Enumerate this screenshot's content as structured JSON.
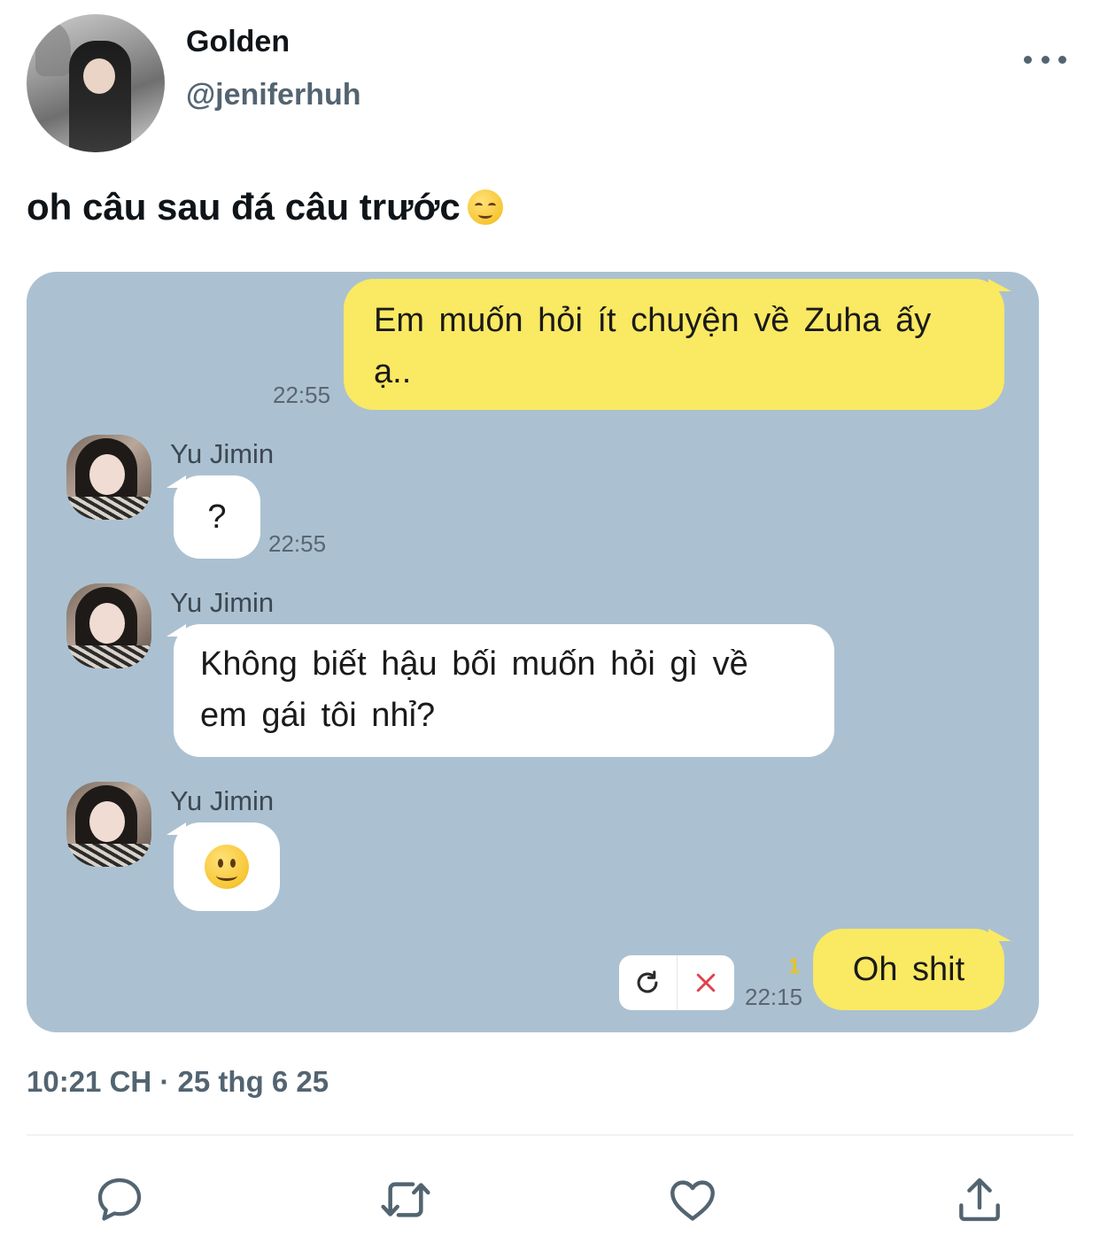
{
  "author": {
    "display_name": "Golden",
    "handle": "@jeniferhuh"
  },
  "tweet": {
    "text": "oh câu sau đá câu trước",
    "emoji": "smiling-face-icon"
  },
  "chat": {
    "messages": [
      {
        "side": "right",
        "text_line1": "Em muốn hỏi ít chuyện về Zuha ấy",
        "text_line2": "ạ..",
        "time": "22:55"
      },
      {
        "side": "left",
        "sender": "Yu Jimin",
        "text": "?",
        "time": "22:55"
      },
      {
        "side": "left",
        "sender": "Yu Jimin",
        "text_line1": "Không biết hậu bối muốn hỏi gì về",
        "text_line2": "em gái tôi nhỉ?"
      },
      {
        "side": "left",
        "sender": "Yu Jimin",
        "emoji": "slightly-smiling-face-icon"
      },
      {
        "side": "right",
        "text": "Oh shit",
        "time": "22:15",
        "unread": "1"
      }
    ],
    "colors": {
      "background": "#abc1d1",
      "outgoing": "#fae962",
      "incoming": "#ffffff"
    }
  },
  "footer": {
    "timestamp": "10:21 CH · 25 thg 6 25"
  },
  "actions": [
    {
      "name": "reply",
      "icon": "speech-bubble-icon"
    },
    {
      "name": "retweet",
      "icon": "retweet-icon"
    },
    {
      "name": "like",
      "icon": "heart-icon"
    },
    {
      "name": "share",
      "icon": "share-upload-icon"
    }
  ]
}
